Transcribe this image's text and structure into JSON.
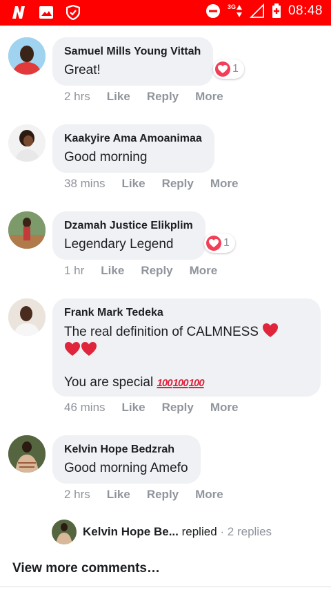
{
  "status_bar": {
    "time": "08:48",
    "network": "3G",
    "icons": [
      "n-app-icon",
      "image-icon",
      "shield-icon",
      "do-not-disturb-icon",
      "signal-icon",
      "battery-icon"
    ],
    "bg_color": "#ff0000"
  },
  "comments": [
    {
      "author": "Samuel Mills Young Vittah",
      "text": "Great!",
      "time": "2 hrs",
      "like": "Like",
      "reply": "Reply",
      "more": "More",
      "reaction_count": "1"
    },
    {
      "author": "Kaakyire Ama Amoanimaa",
      "text": "Good morning",
      "time": "38 mins",
      "like": "Like",
      "reply": "Reply",
      "more": "More"
    },
    {
      "author": "Dzamah Justice Elikplim",
      "text": "Legendary Legend",
      "time": "1 hr",
      "like": "Like",
      "reply": "Reply",
      "more": "More",
      "reaction_count": "1"
    },
    {
      "author": "Frank Mark Tedeka",
      "text_line1": "The real definition of CALMNESS",
      "text_line3": "You are special",
      "hundred_emoji": "100",
      "time": "46 mins",
      "like": "Like",
      "reply": "Reply",
      "more": "More"
    },
    {
      "author": "Kelvin Hope Bedzrah",
      "text": "Good morning Amefo",
      "time": "2 hrs",
      "like": "Like",
      "reply": "Reply",
      "more": "More"
    }
  ],
  "reply_summary": {
    "author": "Kelvin Hope Be...",
    "action": "replied",
    "count": "· 2 replies"
  },
  "view_more": "View more comments…",
  "colors": {
    "bubble": "#f0f1f4",
    "meta_text": "#90949c",
    "heart": "#f33e58"
  }
}
